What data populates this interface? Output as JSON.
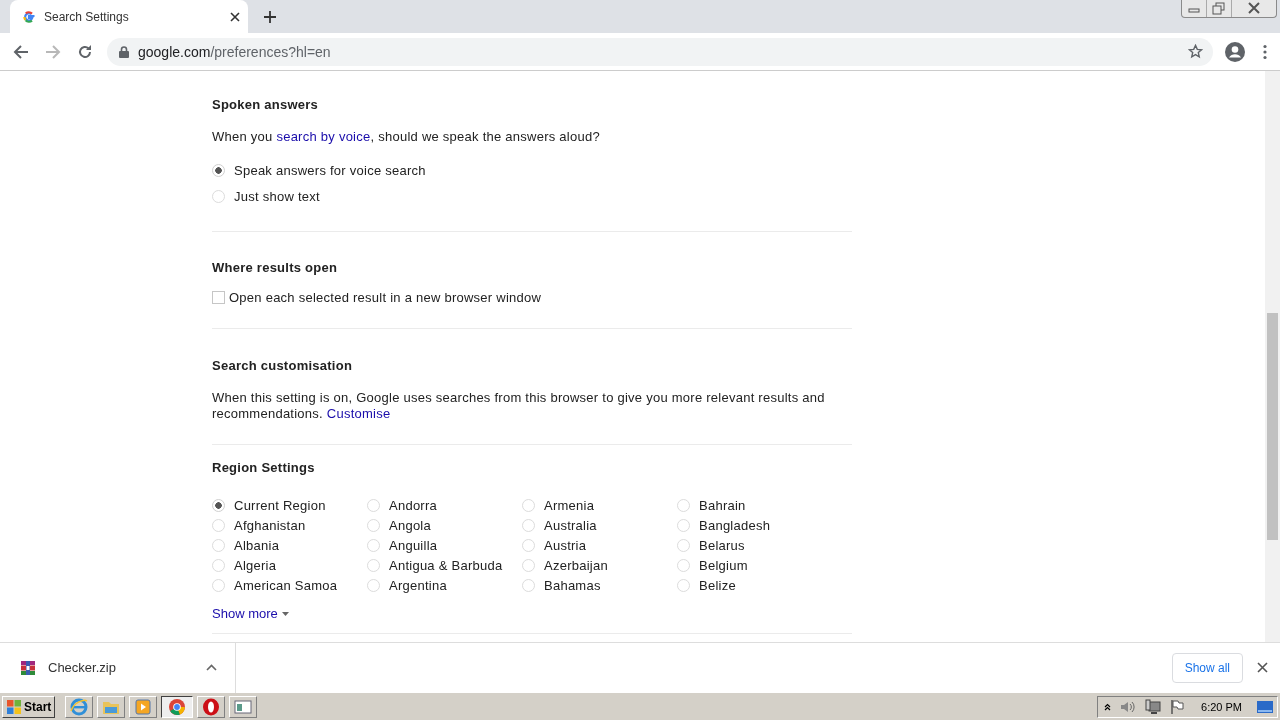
{
  "browser": {
    "tab": {
      "title": "Search Settings"
    },
    "nav": [
      {
        "kind": "back",
        "disabled": false
      },
      {
        "kind": "forward",
        "disabled": true
      },
      {
        "kind": "reload",
        "disabled": false
      }
    ],
    "address": {
      "host": "google.com",
      "path": "/preferences?hl=en"
    }
  },
  "sections": [
    {
      "kind": "radio",
      "title": "Spoken answers",
      "description": {
        "before": "When you ",
        "link": "search by voice",
        "after": ", should we speak the answers aloud?"
      },
      "options": [
        {
          "label": "Speak answers for voice search",
          "selected": true
        },
        {
          "label": "Just show text",
          "selected": false
        }
      ]
    },
    {
      "kind": "checkbox",
      "title": "Where results open",
      "options": [
        {
          "label": "Open each selected result in a new browser window",
          "checked": false
        }
      ]
    },
    {
      "kind": "text",
      "title": "Search customisation",
      "description": {
        "before": "When this setting is on, Google uses searches from this browser to give you more relevant results and recommendations. ",
        "link": "Customise"
      }
    },
    {
      "kind": "region",
      "title": "Region Settings",
      "options": [
        {
          "label": "Current Region",
          "selected": true
        },
        {
          "label": "Afghanistan",
          "selected": false
        },
        {
          "label": "Albania",
          "selected": false
        },
        {
          "label": "Algeria",
          "selected": false
        },
        {
          "label": "American Samoa",
          "selected": false
        },
        {
          "label": "Andorra",
          "selected": false
        },
        {
          "label": "Angola",
          "selected": false
        },
        {
          "label": "Anguilla",
          "selected": false
        },
        {
          "label": "Antigua & Barbuda",
          "selected": false
        },
        {
          "label": "Argentina",
          "selected": false
        },
        {
          "label": "Armenia",
          "selected": false
        },
        {
          "label": "Australia",
          "selected": false
        },
        {
          "label": "Austria",
          "selected": false
        },
        {
          "label": "Azerbaijan",
          "selected": false
        },
        {
          "label": "Bahamas",
          "selected": false
        },
        {
          "label": "Bahrain",
          "selected": false
        },
        {
          "label": "Bangladesh",
          "selected": false
        },
        {
          "label": "Belarus",
          "selected": false
        },
        {
          "label": "Belgium",
          "selected": false
        },
        {
          "label": "Belize",
          "selected": false
        }
      ],
      "more": "Show more"
    }
  ],
  "download": {
    "file": "Checker.zip",
    "show_all": "Show all"
  },
  "taskbar": {
    "start": "Start",
    "apps": [
      {
        "kind": "ie",
        "selected": false
      },
      {
        "kind": "folder",
        "selected": false
      },
      {
        "kind": "media",
        "selected": false
      },
      {
        "kind": "chrome",
        "selected": true
      },
      {
        "kind": "opera",
        "selected": false
      },
      {
        "kind": "window",
        "selected": false
      }
    ],
    "clock": "6:20 PM"
  }
}
